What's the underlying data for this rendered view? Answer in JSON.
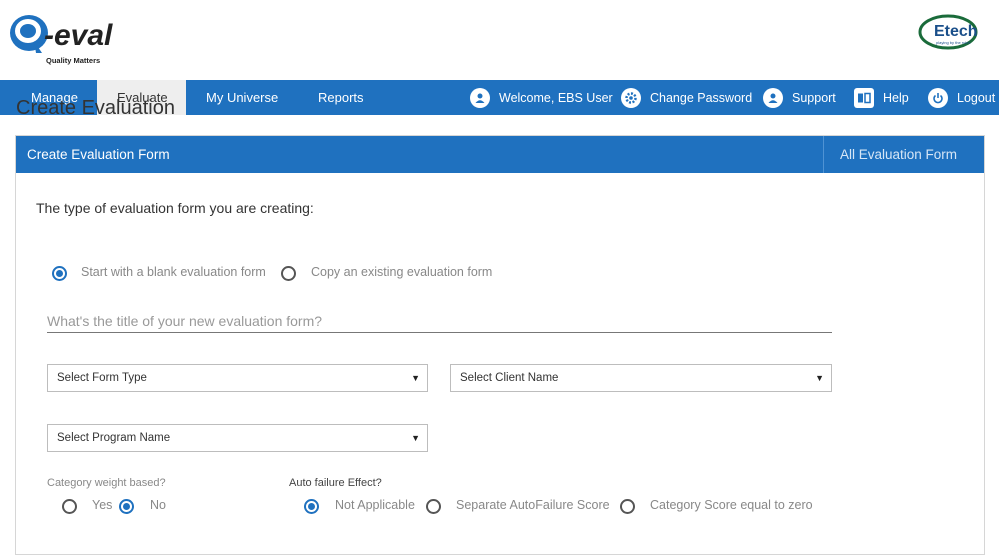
{
  "header": {
    "logo_text": "Q-eval",
    "logo_tagline": "Quality Matters",
    "partner_logo_text": "Etech"
  },
  "nav": {
    "items": [
      {
        "label": "Manage"
      },
      {
        "label": "Evaluate"
      },
      {
        "label": "My Universe"
      },
      {
        "label": "Reports"
      }
    ],
    "welcome": "Welcome, EBS User",
    "change_password": "Change Password",
    "support": "Support",
    "help": "Help",
    "logout": "Logout"
  },
  "page": {
    "title": "Create Evaluation"
  },
  "card": {
    "title": "Create Evaluation Form",
    "link": "All Evaluation Form"
  },
  "form": {
    "prompt": "The type of evaluation form you are creating:",
    "start_options": [
      {
        "label": "Start with a blank evaluation form",
        "selected": true
      },
      {
        "label": "Copy an existing evaluation form",
        "selected": false
      }
    ],
    "title_placeholder": "What's the title of your new evaluation form?",
    "form_type": "Select Form Type",
    "client_name": "Select Client Name",
    "program_name": "Select Program Name",
    "category_weight_label": "Category weight based?",
    "category_weight_options": [
      {
        "label": "Yes",
        "selected": false
      },
      {
        "label": "No",
        "selected": true
      }
    ],
    "auto_failure_label": "Auto failure Effect?",
    "auto_failure_options": [
      {
        "label": "Not Applicable",
        "selected": true
      },
      {
        "label": "Separate AutoFailure Score",
        "selected": false
      },
      {
        "label": "Category Score equal to zero",
        "selected": false
      }
    ]
  },
  "colors": {
    "primary": "#1f71bf",
    "nav_active_bg": "#eeeeee"
  }
}
